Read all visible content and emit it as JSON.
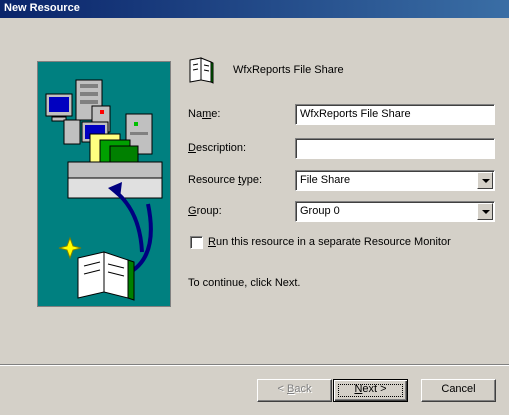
{
  "window": {
    "title": "New Resource"
  },
  "header": {
    "icon": "open-book-icon",
    "text": "WfxReports File Share"
  },
  "form": {
    "name_label_pre": "Na",
    "name_label_u": "m",
    "name_label_post": "e:",
    "name_value": "WfxReports File Share",
    "desc_label_u": "D",
    "desc_label_post": "escription:",
    "desc_value": "",
    "type_label_pre": "Resource ",
    "type_label_u": "t",
    "type_label_post": "ype:",
    "type_value": "File Share",
    "group_label_u": "G",
    "group_label_post": "roup:",
    "group_value": "Group 0",
    "checkbox_u": "R",
    "checkbox_post": "un this resource in a separate Resource Monitor",
    "checkbox_checked": false
  },
  "instructions": "To continue, click Next.",
  "buttons": {
    "back_pre": "< ",
    "back_u": "B",
    "back_post": "ack",
    "next_u": "N",
    "next_post": "ext >",
    "cancel": "Cancel"
  },
  "icons": {
    "art": [
      "server-icon",
      "monitor-icon",
      "file-box-icon",
      "curved-arrow-icon",
      "sparkle-book-icon"
    ]
  }
}
